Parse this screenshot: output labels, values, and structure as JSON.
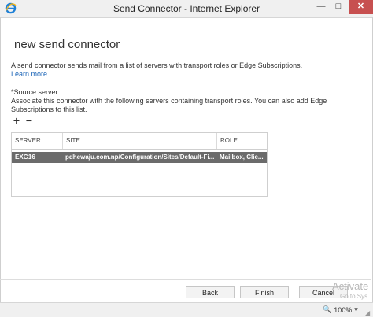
{
  "window": {
    "title": "Send Connector - Internet Explorer",
    "minimize": "—",
    "maximize": "□",
    "close": "✕"
  },
  "page": {
    "title": "new send connector",
    "description": "A send connector sends mail from a list of servers with transport roles or Edge Subscriptions.",
    "learn_more": "Learn more...",
    "source_label": "*Source server:",
    "source_help": "Associate this connector with the following servers containing transport roles. You can also add Edge Subscriptions to this list."
  },
  "toolbar": {
    "add": "+",
    "remove": "−"
  },
  "table": {
    "columns": [
      "SERVER",
      "SITE",
      "ROLE"
    ],
    "rows": [
      {
        "server": "EXG16",
        "site": "pdhewaju.com.np/Configuration/Sites/Default-Fi...",
        "role": "Mailbox, Clie..."
      }
    ]
  },
  "buttons": {
    "back": "Back",
    "finish": "Finish",
    "cancel": "Cancel"
  },
  "status": {
    "zoom": "100%",
    "zoom_icon": "🔍",
    "zoom_arrow": "▾"
  },
  "watermark": {
    "line1": "Activate",
    "line2": "Go to Sys"
  }
}
